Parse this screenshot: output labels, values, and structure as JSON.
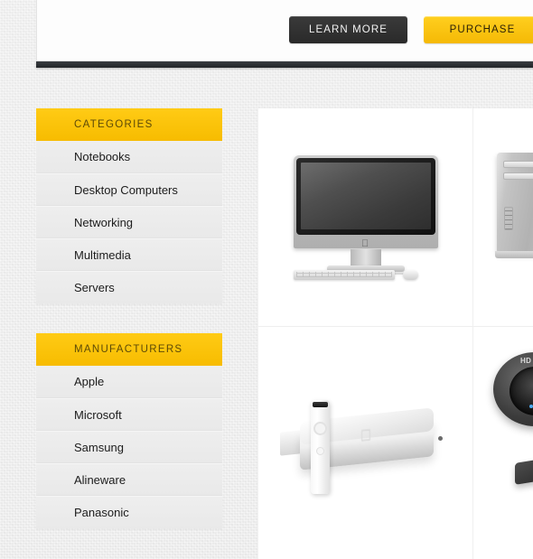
{
  "header": {
    "learn_more_label": "LEARN MORE",
    "purchase_label": "PURCHASE"
  },
  "sidebar": {
    "panels": [
      {
        "title": "CATEGORIES",
        "items": [
          {
            "label": "Notebooks"
          },
          {
            "label": "Desktop Computers"
          },
          {
            "label": "Networking"
          },
          {
            "label": "Multimedia"
          },
          {
            "label": "Servers"
          }
        ]
      },
      {
        "title": "MANUFACTURERS",
        "items": [
          {
            "label": "Apple"
          },
          {
            "label": "Microsoft"
          },
          {
            "label": "Samsung"
          },
          {
            "label": "Alineware"
          },
          {
            "label": "Panasonic"
          }
        ]
      }
    ]
  },
  "products": [
    {
      "name": "imac-all-in-one-desktop",
      "logo": ""
    },
    {
      "name": "mac-pro-tower-desktop"
    },
    {
      "name": "mac-mini-with-remote",
      "logo": ""
    },
    {
      "name": "hd-webcam",
      "badge": "HD"
    }
  ],
  "colors": {
    "accent_yellow": "#F7BC00",
    "dark_bar": "#2C2F33",
    "panel_gray": "#EDEDED",
    "page_bg": "#EEEEEE"
  }
}
